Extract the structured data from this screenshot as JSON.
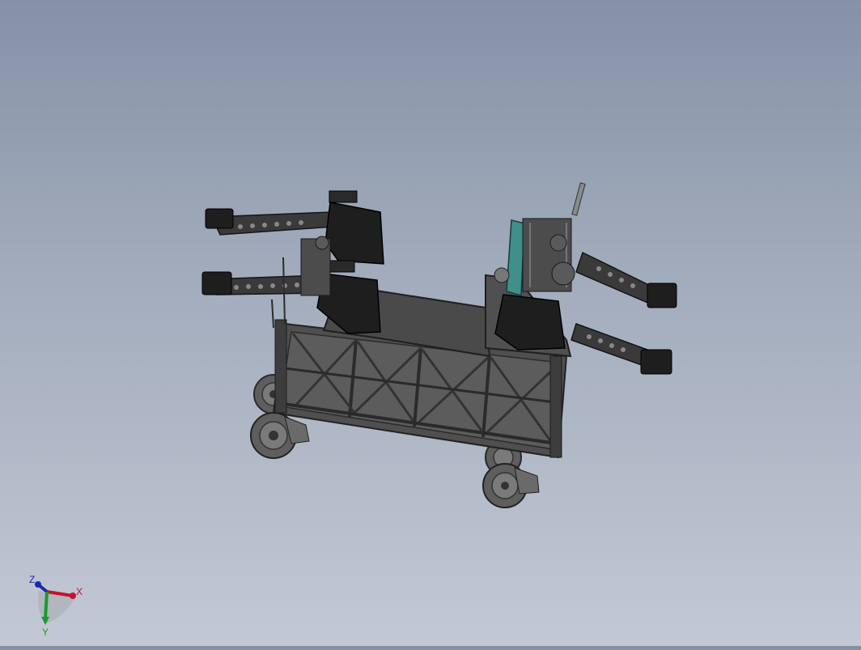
{
  "viewport": {
    "background_top": "#8592a6",
    "background_bottom": "#c3c8d4"
  },
  "model": {
    "icon": "cart-fixture-3d-model-icon",
    "colors": {
      "dark_part": "#1e1e1e",
      "frame": "#555555",
      "table_top": "#4a4a4a",
      "teal_part": "#3f8f8a",
      "wheel": "#6a6a6a"
    }
  },
  "triad": {
    "x_label": "X",
    "y_label": "Y",
    "z_label": "Z",
    "x_color": "#c8102e",
    "y_color": "#1a9a2a",
    "z_color": "#1a2ab0"
  }
}
